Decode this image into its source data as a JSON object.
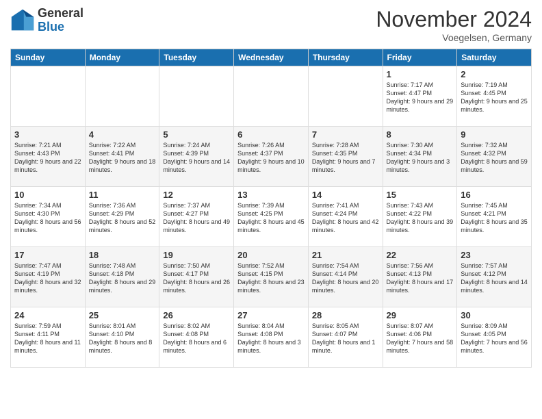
{
  "header": {
    "logo_general": "General",
    "logo_blue": "Blue",
    "month_title": "November 2024",
    "subtitle": "Voegelsen, Germany"
  },
  "days_of_week": [
    "Sunday",
    "Monday",
    "Tuesday",
    "Wednesday",
    "Thursday",
    "Friday",
    "Saturday"
  ],
  "weeks": [
    [
      {
        "day": "",
        "info": ""
      },
      {
        "day": "",
        "info": ""
      },
      {
        "day": "",
        "info": ""
      },
      {
        "day": "",
        "info": ""
      },
      {
        "day": "",
        "info": ""
      },
      {
        "day": "1",
        "info": "Sunrise: 7:17 AM\nSunset: 4:47 PM\nDaylight: 9 hours\nand 29 minutes."
      },
      {
        "day": "2",
        "info": "Sunrise: 7:19 AM\nSunset: 4:45 PM\nDaylight: 9 hours\nand 25 minutes."
      }
    ],
    [
      {
        "day": "3",
        "info": "Sunrise: 7:21 AM\nSunset: 4:43 PM\nDaylight: 9 hours\nand 22 minutes."
      },
      {
        "day": "4",
        "info": "Sunrise: 7:22 AM\nSunset: 4:41 PM\nDaylight: 9 hours\nand 18 minutes."
      },
      {
        "day": "5",
        "info": "Sunrise: 7:24 AM\nSunset: 4:39 PM\nDaylight: 9 hours\nand 14 minutes."
      },
      {
        "day": "6",
        "info": "Sunrise: 7:26 AM\nSunset: 4:37 PM\nDaylight: 9 hours\nand 10 minutes."
      },
      {
        "day": "7",
        "info": "Sunrise: 7:28 AM\nSunset: 4:35 PM\nDaylight: 9 hours\nand 7 minutes."
      },
      {
        "day": "8",
        "info": "Sunrise: 7:30 AM\nSunset: 4:34 PM\nDaylight: 9 hours\nand 3 minutes."
      },
      {
        "day": "9",
        "info": "Sunrise: 7:32 AM\nSunset: 4:32 PM\nDaylight: 8 hours\nand 59 minutes."
      }
    ],
    [
      {
        "day": "10",
        "info": "Sunrise: 7:34 AM\nSunset: 4:30 PM\nDaylight: 8 hours\nand 56 minutes."
      },
      {
        "day": "11",
        "info": "Sunrise: 7:36 AM\nSunset: 4:29 PM\nDaylight: 8 hours\nand 52 minutes."
      },
      {
        "day": "12",
        "info": "Sunrise: 7:37 AM\nSunset: 4:27 PM\nDaylight: 8 hours\nand 49 minutes."
      },
      {
        "day": "13",
        "info": "Sunrise: 7:39 AM\nSunset: 4:25 PM\nDaylight: 8 hours\nand 45 minutes."
      },
      {
        "day": "14",
        "info": "Sunrise: 7:41 AM\nSunset: 4:24 PM\nDaylight: 8 hours\nand 42 minutes."
      },
      {
        "day": "15",
        "info": "Sunrise: 7:43 AM\nSunset: 4:22 PM\nDaylight: 8 hours\nand 39 minutes."
      },
      {
        "day": "16",
        "info": "Sunrise: 7:45 AM\nSunset: 4:21 PM\nDaylight: 8 hours\nand 35 minutes."
      }
    ],
    [
      {
        "day": "17",
        "info": "Sunrise: 7:47 AM\nSunset: 4:19 PM\nDaylight: 8 hours\nand 32 minutes."
      },
      {
        "day": "18",
        "info": "Sunrise: 7:48 AM\nSunset: 4:18 PM\nDaylight: 8 hours\nand 29 minutes."
      },
      {
        "day": "19",
        "info": "Sunrise: 7:50 AM\nSunset: 4:17 PM\nDaylight: 8 hours\nand 26 minutes."
      },
      {
        "day": "20",
        "info": "Sunrise: 7:52 AM\nSunset: 4:15 PM\nDaylight: 8 hours\nand 23 minutes."
      },
      {
        "day": "21",
        "info": "Sunrise: 7:54 AM\nSunset: 4:14 PM\nDaylight: 8 hours\nand 20 minutes."
      },
      {
        "day": "22",
        "info": "Sunrise: 7:56 AM\nSunset: 4:13 PM\nDaylight: 8 hours\nand 17 minutes."
      },
      {
        "day": "23",
        "info": "Sunrise: 7:57 AM\nSunset: 4:12 PM\nDaylight: 8 hours\nand 14 minutes."
      }
    ],
    [
      {
        "day": "24",
        "info": "Sunrise: 7:59 AM\nSunset: 4:11 PM\nDaylight: 8 hours\nand 11 minutes."
      },
      {
        "day": "25",
        "info": "Sunrise: 8:01 AM\nSunset: 4:10 PM\nDaylight: 8 hours\nand 8 minutes."
      },
      {
        "day": "26",
        "info": "Sunrise: 8:02 AM\nSunset: 4:08 PM\nDaylight: 8 hours\nand 6 minutes."
      },
      {
        "day": "27",
        "info": "Sunrise: 8:04 AM\nSunset: 4:08 PM\nDaylight: 8 hours\nand 3 minutes."
      },
      {
        "day": "28",
        "info": "Sunrise: 8:05 AM\nSunset: 4:07 PM\nDaylight: 8 hours\nand 1 minute."
      },
      {
        "day": "29",
        "info": "Sunrise: 8:07 AM\nSunset: 4:06 PM\nDaylight: 7 hours\nand 58 minutes."
      },
      {
        "day": "30",
        "info": "Sunrise: 8:09 AM\nSunset: 4:05 PM\nDaylight: 7 hours\nand 56 minutes."
      }
    ]
  ]
}
